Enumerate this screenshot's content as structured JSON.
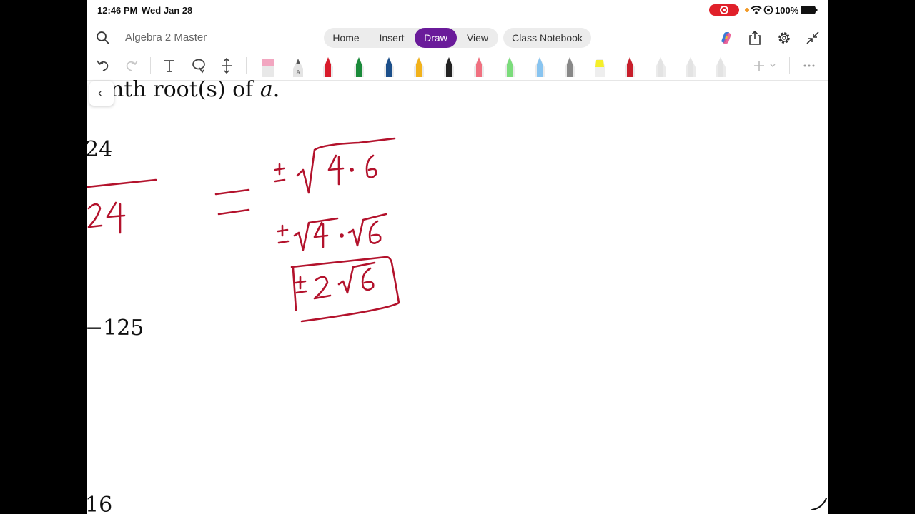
{
  "status_bar": {
    "time": "12:46 PM",
    "date": "Wed Jan 28",
    "battery": "100%"
  },
  "header": {
    "notebook_title": "Algebra 2 Master",
    "tabs": [
      {
        "label": "Home"
      },
      {
        "label": "Insert"
      },
      {
        "label": "Draw",
        "active": true
      },
      {
        "label": "View"
      }
    ],
    "class_notebook": "Class Notebook"
  },
  "toolbar": {
    "tools": [
      "undo-icon",
      "redo-icon",
      "text-icon",
      "lasso-icon",
      "insert-space-icon"
    ],
    "pens": [
      {
        "kind": "eraser",
        "color": "#f2a6c0"
      },
      {
        "kind": "pencil",
        "color": "#555555"
      },
      {
        "kind": "pen",
        "color": "#d81b2b"
      },
      {
        "kind": "pen",
        "color": "#1a8a3a"
      },
      {
        "kind": "pen",
        "color": "#1c4f8a"
      },
      {
        "kind": "pen",
        "color": "#f2b21b"
      },
      {
        "kind": "pen",
        "color": "#222222"
      },
      {
        "kind": "pen",
        "color": "#f07080"
      },
      {
        "kind": "pen",
        "color": "#7bdc7b"
      },
      {
        "kind": "pen",
        "color": "#88c4f0"
      },
      {
        "kind": "pen",
        "color": "#888888"
      },
      {
        "kind": "highlighter",
        "color": "#f5ef2a"
      },
      {
        "kind": "pen",
        "color": "#c81e2b"
      },
      {
        "kind": "pen",
        "color": "#e3e3e3"
      },
      {
        "kind": "pen",
        "color": "#e3e3e3"
      },
      {
        "kind": "pen",
        "color": "#e3e3e3"
      }
    ]
  },
  "page": {
    "heading_text": "nth root(s) of",
    "heading_var": "a",
    "heading_end": ".",
    "problem_1": "24",
    "problem_2": "−125",
    "problem_3": "16",
    "ink_color": "#b3122c"
  }
}
